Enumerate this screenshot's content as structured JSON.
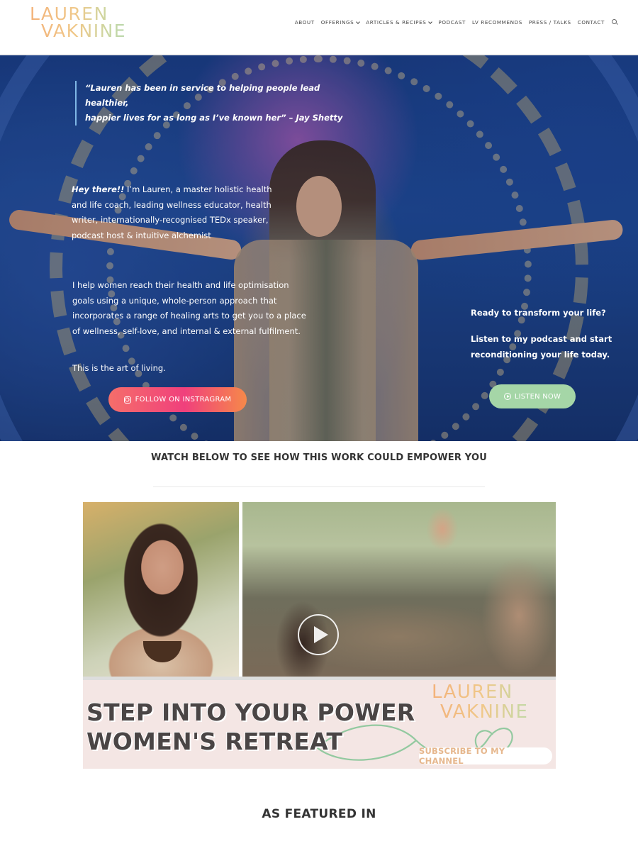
{
  "brand": {
    "logo_line1": "LAUREN",
    "logo_line2": "VAKNINE",
    "gradient_colors": [
      "#f3b27a",
      "#f0c889",
      "#c9d7a2",
      "#a8d7b7"
    ]
  },
  "nav": {
    "items": [
      {
        "label": "ABOUT",
        "dropdown": false
      },
      {
        "label": "OFFERINGS",
        "dropdown": true
      },
      {
        "label": "ARTICLES & RECIPES",
        "dropdown": true
      },
      {
        "label": "PODCAST",
        "dropdown": false
      },
      {
        "label": "LV RECOMMENDS",
        "dropdown": false
      },
      {
        "label": "PRESS / TALKS",
        "dropdown": false
      },
      {
        "label": "CONTACT",
        "dropdown": false
      }
    ],
    "search_icon": "search-icon"
  },
  "hero": {
    "quote_line1": "“Lauren has been in service to helping people lead healthier,",
    "quote_line2": "happier lives for as long as I’ve known her” – Jay Shetty",
    "intro_bold": "Hey there!!",
    "intro_text": " I’m Lauren, a master holistic health and life coach, leading wellness educator, health writer, internationally-recognised TEDx speaker, podcast host & intuitive alchemist",
    "body_text": "I help women reach their health and life optimisation goals using a unique, whole-person approach that incorporates a range of healing arts to get you to a place of wellness, self-love, and internal & external fulfilment.",
    "art_text": "This is the art of living.",
    "instagram_button": "FOLLOW ON INSTRAGRAM",
    "cta_line1": "Ready to transform your life?",
    "cta_line2": "Listen to my podcast and start reconditioning your life today.",
    "listen_button": "LISTEN NOW",
    "colors": {
      "instagram_start": "#f56e6a",
      "instagram_end": "#f6894a",
      "listen": "#a5d6a7",
      "quote_bar": "#7fb7e6"
    }
  },
  "watch": {
    "heading": "WATCH BELOW TO SEE HOW THIS WORK COULD EMPOWER YOU",
    "video": {
      "title_line1": "STEP INTO YOUR POWER",
      "title_line2": "WOMEN'S RETREAT",
      "logo_line1": "LAUREN",
      "logo_line2": "VAKNINE",
      "subscribe_label": "SUBSCRIBE TO MY CHANNEL",
      "play_icon": "play-icon"
    }
  },
  "featured": {
    "heading": "AS FEATURED IN"
  }
}
